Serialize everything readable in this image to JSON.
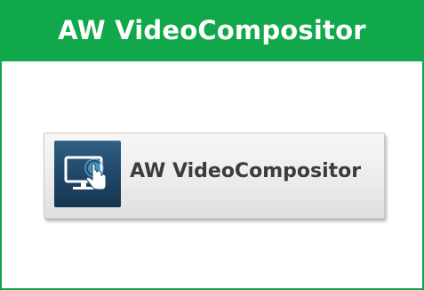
{
  "header": {
    "title": "AW VideoCompositor",
    "background_color": "#10a84a",
    "text_color": "#ffffff"
  },
  "app_button": {
    "label": "AW VideoCompositor",
    "icon": "monitor-touch-icon",
    "icon_background_color": "#1f4666",
    "label_color": "#3c3c3c"
  }
}
